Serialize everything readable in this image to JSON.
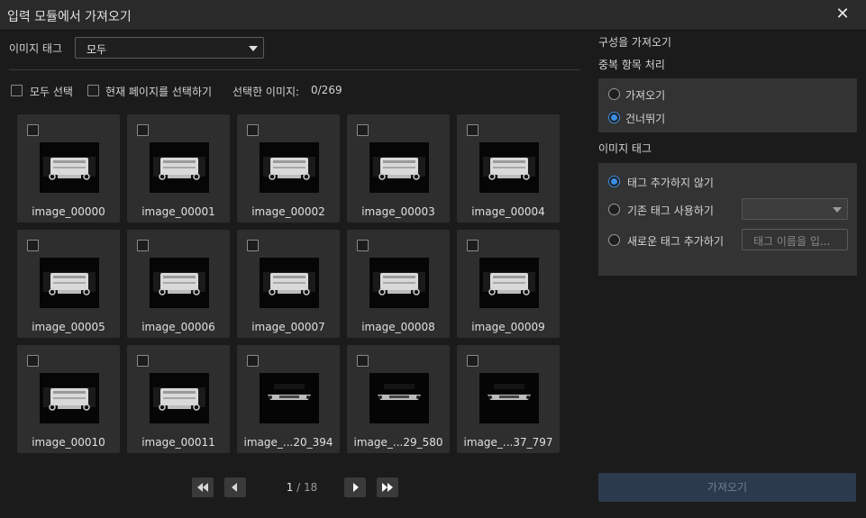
{
  "window": {
    "title": "입력 모듈에서 가져오기"
  },
  "left": {
    "image_tag_label": "이미지 태그",
    "image_tag_value": "모두",
    "select_all_label": "모두 선택",
    "select_page_label": "현재 페이지를 선택하기",
    "selected_label": "선택한 이미지:",
    "selected_count": "0/269",
    "tiles": [
      {
        "name": "image_00000",
        "kind": "a"
      },
      {
        "name": "image_00001",
        "kind": "a"
      },
      {
        "name": "image_00002",
        "kind": "a"
      },
      {
        "name": "image_00003",
        "kind": "a"
      },
      {
        "name": "image_00004",
        "kind": "a"
      },
      {
        "name": "image_00005",
        "kind": "a"
      },
      {
        "name": "image_00006",
        "kind": "a"
      },
      {
        "name": "image_00007",
        "kind": "a"
      },
      {
        "name": "image_00008",
        "kind": "a"
      },
      {
        "name": "image_00009",
        "kind": "a"
      },
      {
        "name": "image_00010",
        "kind": "a"
      },
      {
        "name": "image_00011",
        "kind": "a"
      },
      {
        "name": "image_...20_394",
        "kind": "b"
      },
      {
        "name": "image_...29_580",
        "kind": "b"
      },
      {
        "name": "image_...37_797",
        "kind": "b"
      }
    ],
    "pager": {
      "current": "1",
      "separator": "/",
      "total": "18"
    }
  },
  "right": {
    "import_config_title": "구성을 가져오기",
    "duplicate_title": "중복 항목 처리",
    "dup_options": [
      "가져오기",
      "건너뛰기"
    ],
    "dup_selected": 1,
    "image_tag_title": "이미지 태그",
    "tag_options": [
      "태그 추가하지 않기",
      "기존 태그 사용하기",
      "새로운 태그 추가하기"
    ],
    "tag_selected": 0,
    "tag_name_placeholder": "태그 이름을 입...",
    "import_button": "가져오기",
    "accent_color": "#3a8fe6"
  }
}
